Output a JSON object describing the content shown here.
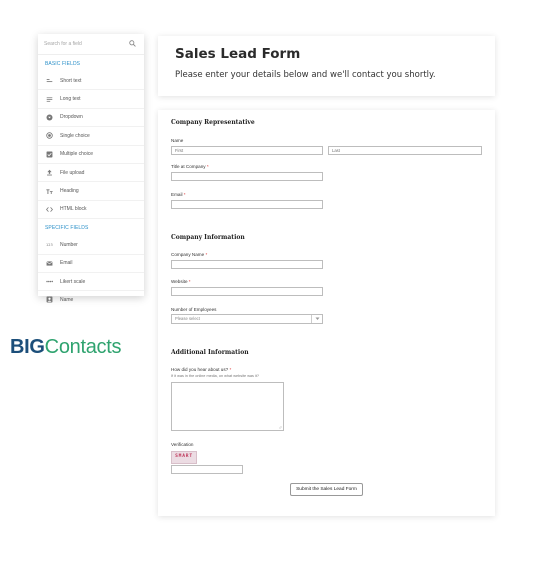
{
  "palette": {
    "search_placeholder": "Search for a field",
    "basic_title": "BASIC FIELDS",
    "basic_items": [
      {
        "label": "Short text",
        "icon": "short-text-icon"
      },
      {
        "label": "Long text",
        "icon": "long-text-icon"
      },
      {
        "label": "Dropdown",
        "icon": "dropdown-icon"
      },
      {
        "label": "Single choice",
        "icon": "radio-icon"
      },
      {
        "label": "Multiple choice",
        "icon": "checkbox-icon"
      },
      {
        "label": "File upload",
        "icon": "upload-icon"
      },
      {
        "label": "Heading",
        "icon": "heading-icon"
      },
      {
        "label": "HTML block",
        "icon": "code-icon"
      }
    ],
    "specific_title": "SPECIFIC FIELDS",
    "specific_items": [
      {
        "label": "Number",
        "icon": "number-icon"
      },
      {
        "label": "Email",
        "icon": "email-icon"
      },
      {
        "label": "Likert scale",
        "icon": "likert-icon"
      },
      {
        "label": "Name",
        "icon": "name-icon"
      }
    ]
  },
  "logo": {
    "big": "BIG",
    "rest": "Contacts"
  },
  "header": {
    "title": "Sales Lead Form",
    "subtitle": "Please enter your details below and we'll contact you shortly."
  },
  "form": {
    "rep_title": "Company Representative",
    "name_label": "Name",
    "first_placeholder": "First",
    "last_placeholder": "Last",
    "title_label": "Title at Company",
    "email_label": "Email",
    "info_title": "Company Information",
    "company_label": "Company Name",
    "website_label": "Website",
    "employees_label": "Number of Employees",
    "employees_value": "Please select",
    "additional_title": "Additional Information",
    "hear_label": "How did you hear about us?",
    "hear_hint": "If it was in the online media, on what website was it?",
    "verification_label": "Verification",
    "captcha_text": "SMART",
    "submit_label": "Submit the Sales Lead Form",
    "required_mark": "*"
  },
  "colors": {
    "accent": "#2a8fc8",
    "logo_dark": "#1c4f7a",
    "logo_green": "#2fa36f",
    "required": "#d33333"
  }
}
